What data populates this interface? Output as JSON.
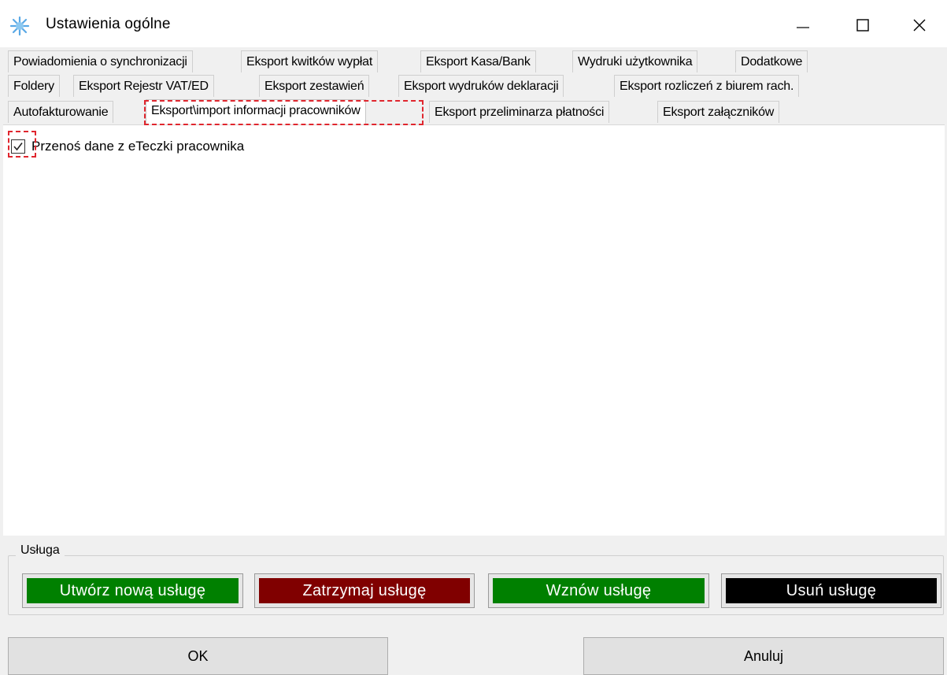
{
  "window": {
    "title": "Ustawienia ogólne",
    "icon": "snowflake-icon",
    "controls": [
      "minimize-icon",
      "maximize-icon",
      "close-icon"
    ]
  },
  "tabs": {
    "row1": [
      "Powiadomienia o synchronizacji",
      "Eksport kwitków wypłat",
      "Eksport Kasa/Bank",
      "Wydruki użytkownika",
      "Dodatkowe"
    ],
    "row2": [
      "Foldery",
      "Eksport Rejestr VAT/ED",
      "Eksport zestawień",
      "Eksport wydruków deklaracji",
      "Eksport rozliczeń z biurem rach."
    ],
    "row3": [
      "Autofakturowanie",
      "Eksport\\import informacji  pracowników",
      "Eksport przeliminarza płatności",
      "Eksport załączników"
    ],
    "active": "Eksport\\import informacji  pracowników"
  },
  "content": {
    "checkbox_label": "Przenoś dane z eTeczki pracownika",
    "checkbox_checked": true
  },
  "service": {
    "legend": "Usługa",
    "create": "Utwórz nową usługę",
    "stop": "Zatrzymaj usługę",
    "resume": "Wznów usługę",
    "delete": "Usuń usługę",
    "colors": {
      "create": "#008000",
      "stop": "#800000",
      "resume": "#008000",
      "delete": "#000000"
    }
  },
  "buttons": {
    "ok": "OK",
    "cancel": "Anuluj"
  },
  "colors": {
    "highlight": "#e0262e"
  }
}
